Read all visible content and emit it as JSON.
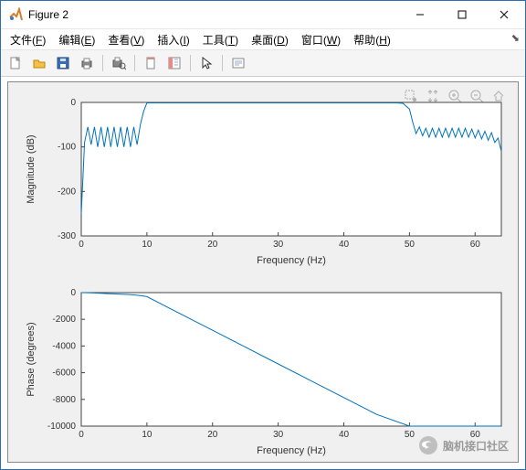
{
  "window": {
    "title": "Figure 2"
  },
  "menu": {
    "file": {
      "label": "文件",
      "key": "F"
    },
    "edit": {
      "label": "编辑",
      "key": "E"
    },
    "view": {
      "label": "查看",
      "key": "V"
    },
    "insert": {
      "label": "插入",
      "key": "I"
    },
    "tools": {
      "label": "工具",
      "key": "T"
    },
    "desktop": {
      "label": "桌面",
      "key": "D"
    },
    "windowm": {
      "label": "窗口",
      "key": "W"
    },
    "help": {
      "label": "帮助",
      "key": "H"
    }
  },
  "toolbar_icons": [
    "new",
    "open",
    "save",
    "print",
    "|",
    "print-preview",
    "|",
    "link",
    "plot-tools",
    "|",
    "pointer",
    "|",
    "annotate"
  ],
  "axes_tools": [
    "brush",
    "pan",
    "zoom-in",
    "zoom-out",
    "home"
  ],
  "watermark": {
    "text": "脑机接口社区"
  },
  "chart_data": [
    {
      "type": "line",
      "title": "",
      "xlabel": "Frequency (Hz)",
      "ylabel": "Magnitude (dB)",
      "xlim": [
        0,
        64
      ],
      "ylim": [
        -300,
        0
      ],
      "xticks": [
        0,
        10,
        20,
        30,
        40,
        50,
        60
      ],
      "yticks": [
        -300,
        -200,
        -100,
        0
      ],
      "series": [
        {
          "name": "mag",
          "x": [
            0,
            0.5,
            1,
            1.5,
            2,
            2.5,
            3,
            3.5,
            4,
            4.5,
            5,
            5.5,
            6,
            6.5,
            7,
            7.5,
            8,
            8.5,
            9,
            9.5,
            10,
            11,
            12,
            15,
            20,
            30,
            40,
            45,
            48,
            49,
            50,
            50.5,
            51,
            51.5,
            52,
            52.5,
            53,
            53.5,
            54,
            54.5,
            55,
            55.5,
            56,
            56.5,
            57,
            57.5,
            58,
            58.5,
            59,
            59.5,
            60,
            60.5,
            61,
            61.5,
            62,
            62.5,
            63,
            63.5,
            64
          ],
          "y": [
            -250,
            -90,
            -55,
            -95,
            -55,
            -100,
            -55,
            -100,
            -55,
            -100,
            -55,
            -100,
            -55,
            -100,
            -55,
            -100,
            -55,
            -95,
            -50,
            -20,
            -1,
            -1,
            -1,
            -1,
            -1,
            -1,
            -1,
            -1,
            -1,
            -2,
            -15,
            -45,
            -70,
            -55,
            -75,
            -58,
            -78,
            -58,
            -78,
            -58,
            -78,
            -58,
            -78,
            -58,
            -78,
            -58,
            -78,
            -58,
            -78,
            -60,
            -80,
            -62,
            -82,
            -65,
            -85,
            -68,
            -90,
            -80,
            -110
          ]
        }
      ]
    },
    {
      "type": "line",
      "title": "",
      "xlabel": "Frequency (Hz)",
      "ylabel": "Phase (degrees)",
      "xlim": [
        0,
        64
      ],
      "ylim": [
        -10000,
        0
      ],
      "xticks": [
        0,
        10,
        20,
        30,
        40,
        50,
        60
      ],
      "yticks": [
        -10000,
        -8000,
        -6000,
        -4000,
        -2000,
        0
      ],
      "series": [
        {
          "name": "phase",
          "x": [
            0,
            1,
            2,
            3,
            4,
            5,
            6,
            7,
            8,
            9,
            10,
            15,
            20,
            25,
            30,
            35,
            40,
            45,
            50,
            51,
            52,
            55,
            60,
            64
          ],
          "y": [
            0,
            -10,
            -30,
            -55,
            -75,
            -95,
            -115,
            -140,
            -170,
            -220,
            -300,
            -1560,
            -2820,
            -4080,
            -5340,
            -6600,
            -7860,
            -9120,
            -10380,
            -10500,
            -10550,
            -10560,
            -10560,
            -10560
          ]
        }
      ]
    }
  ]
}
